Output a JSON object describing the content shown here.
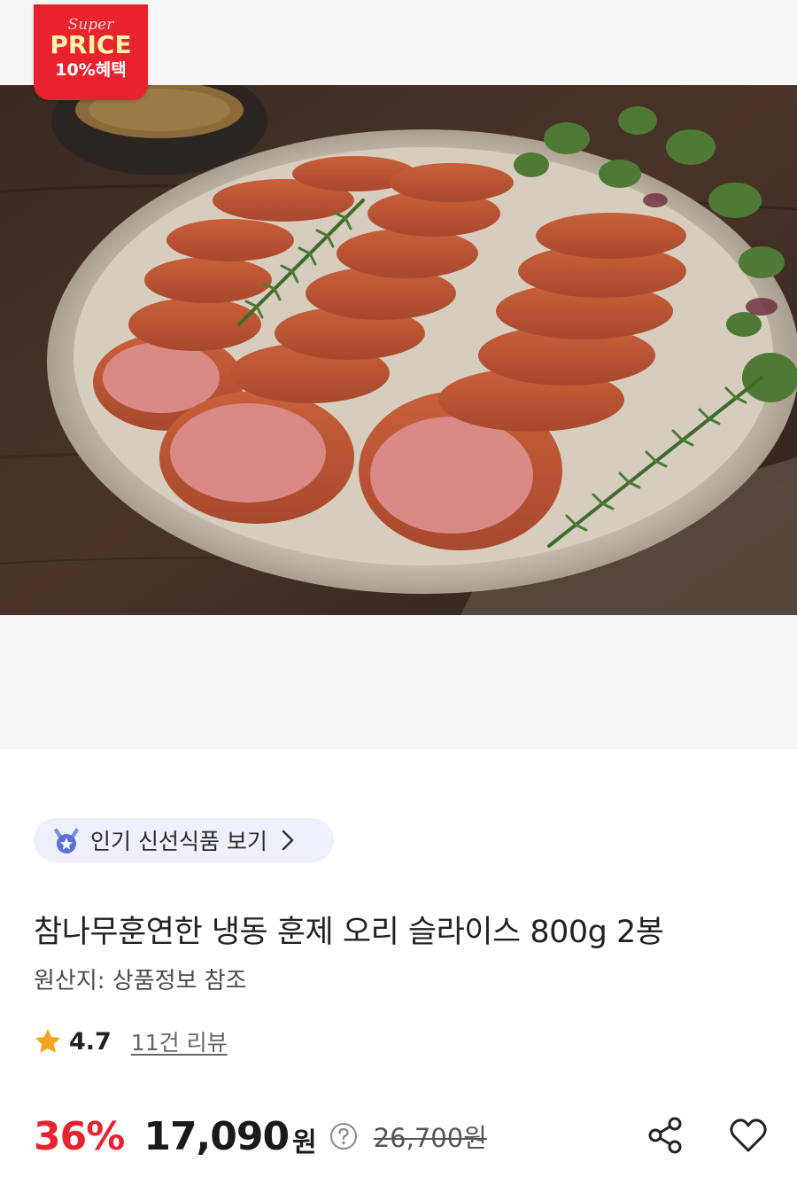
{
  "badge": {
    "super": "Super",
    "price": "PRICE",
    "benefit": "10%혜택"
  },
  "product_image": {
    "alt": "smoked duck slices"
  },
  "chip": {
    "label": "인기 신선식품 보기"
  },
  "product": {
    "title": "참나무훈연한 냉동 훈제 오리 슬라이스 800g 2봉",
    "origin": "원산지: 상품정보 참조",
    "rating": "4.7",
    "reviews": "11건 리뷰"
  },
  "pricing": {
    "discount": "36%",
    "sale_price": "17,090",
    "currency": "원",
    "original_price": "26,700원"
  },
  "colors": {
    "accent_red": "#e8232f",
    "star": "#f4a51c",
    "chip_bg": "#eef1fb"
  },
  "icons": {
    "chip": "medal-icon",
    "chevron": "chevron-right-icon",
    "star": "star-icon",
    "help": "question-circle-icon",
    "share": "share-icon",
    "wishlist": "heart-icon"
  }
}
